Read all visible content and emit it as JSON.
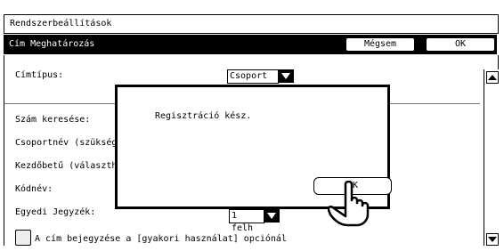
{
  "window": {
    "title": "Rendszerbeállítások"
  },
  "header": {
    "title": "Cím Meghatározás",
    "cancel_label": "Mégsem",
    "ok_label": "OK"
  },
  "form": {
    "address_type_label": "Címtípus:",
    "address_type_value": "Csoport",
    "number_search_label": "Szám keresése:",
    "group_name_label": "Csoportnév (szükség",
    "initial_label": "Kezdőbetű (választha",
    "code_name_label": "Kódnév:",
    "custom_tag_label": "Egyedi Jegyzék:",
    "custom_tag_value": "1 felh",
    "checkbox_label": "A cím bejegyzése a [gyakori használat] opciónál"
  },
  "dialog": {
    "message": "Regisztráció kész.",
    "ok_label": "OK"
  },
  "icons": {
    "scroll_up": "scroll-up-arrow-icon",
    "scroll_down": "scroll-down-arrow-icon",
    "pointer": "pointing-hand-icon"
  }
}
